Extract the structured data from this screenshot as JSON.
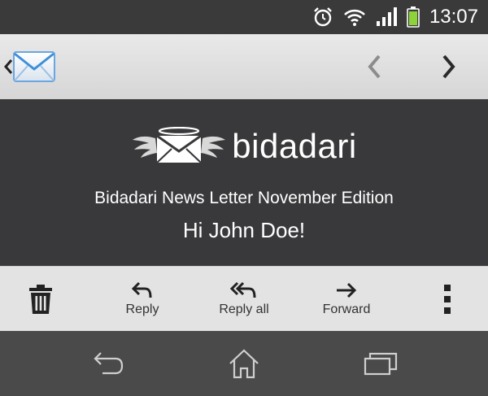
{
  "status_bar": {
    "time": "13:07",
    "icons": [
      "alarm-icon",
      "wifi-icon",
      "signal-icon",
      "battery-icon"
    ]
  },
  "top_bar": {
    "app_icon": "email-icon",
    "icons": [
      "up-chevron-icon",
      "prev-icon",
      "next-icon"
    ]
  },
  "email": {
    "brand": "bidadari",
    "subject": "Bidadari News Letter November Edition",
    "greeting": "Hi John Doe!"
  },
  "actions": {
    "reply_label": "Reply",
    "reply_all_label": "Reply all",
    "forward_label": "Forward",
    "icons": [
      "trash-icon",
      "reply-icon",
      "reply-all-icon",
      "forward-icon",
      "overflow-menu-icon"
    ]
  },
  "nav": {
    "icons": [
      "back-icon",
      "home-icon",
      "recent-apps-icon"
    ]
  },
  "colors": {
    "status_bg": "#3a3a3a",
    "content_bg": "#39393b",
    "bar_bg": "#e3e3e3",
    "nav_bg": "#4a4a4a",
    "battery": "#8cd33a"
  }
}
